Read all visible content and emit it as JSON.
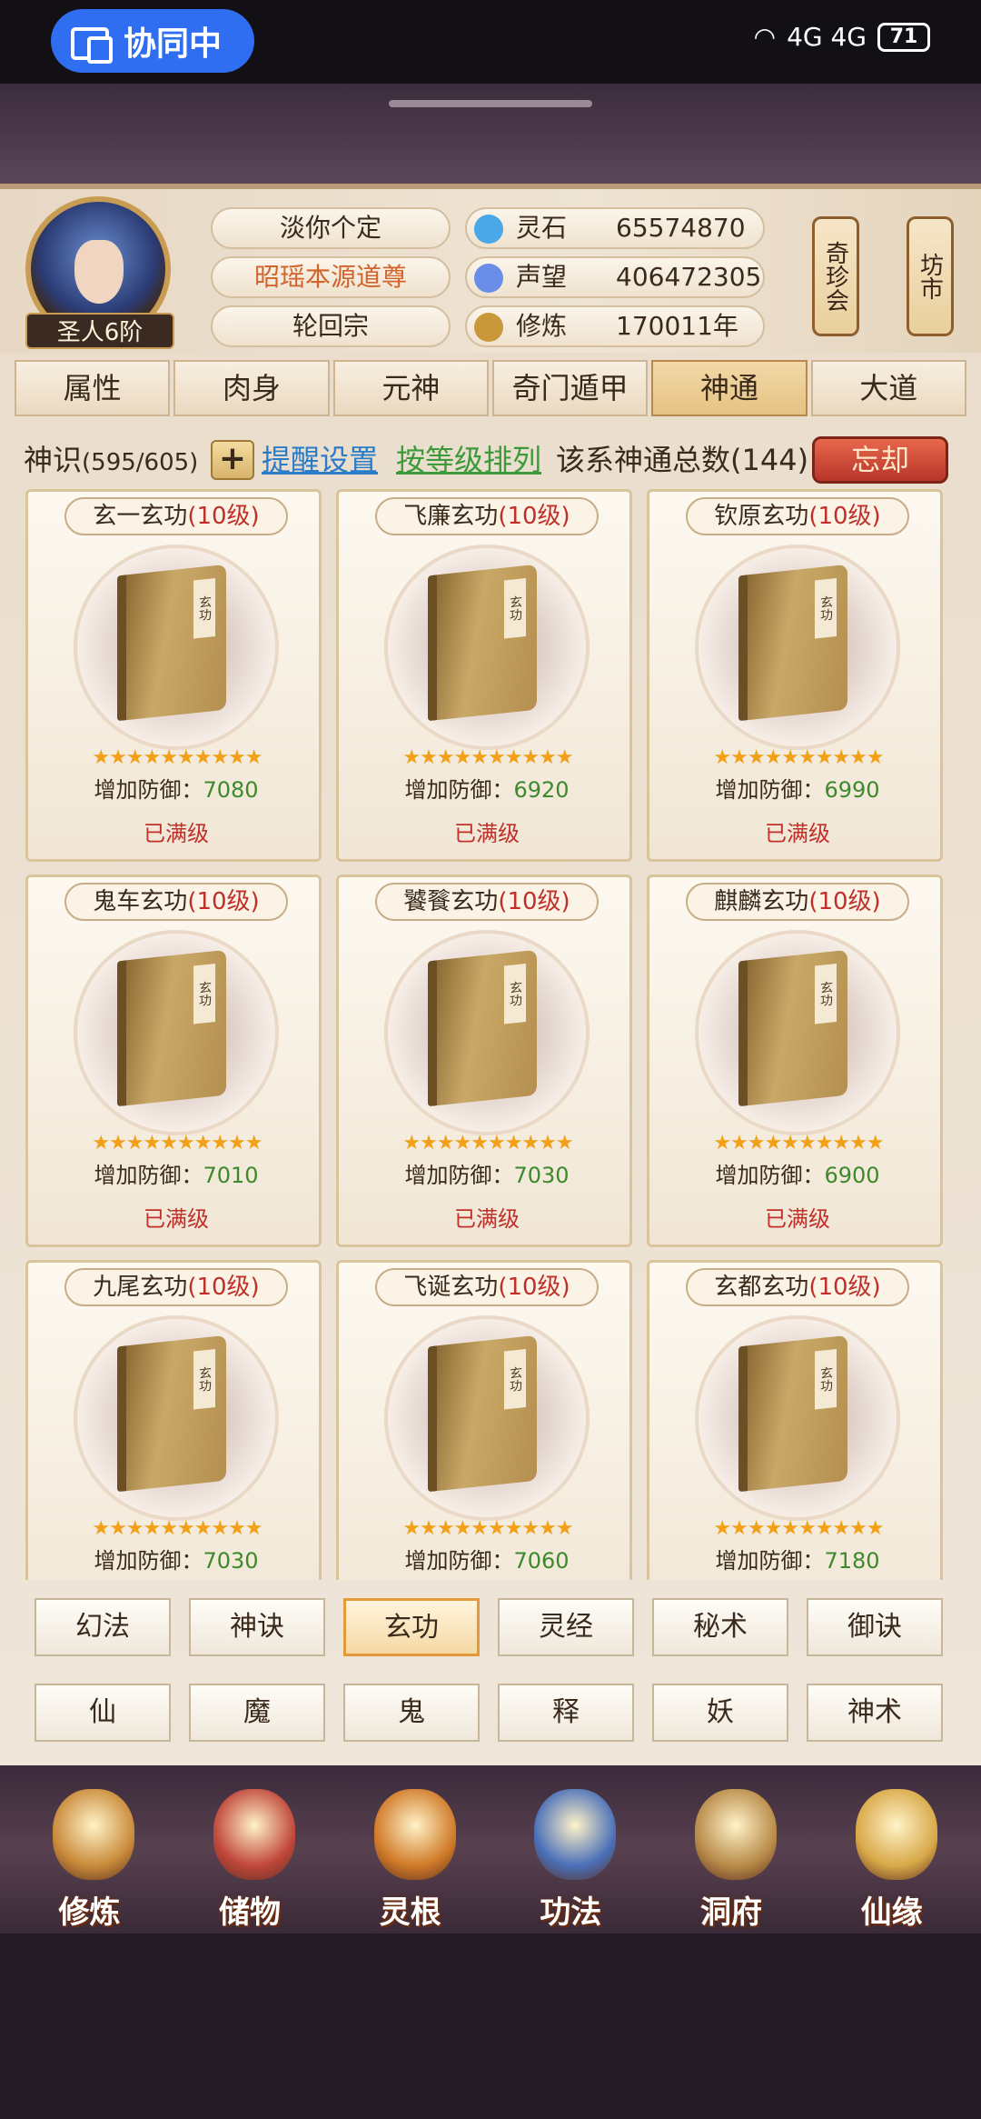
{
  "status": {
    "coop": "协同中",
    "network": "4G 4G",
    "battery": "71"
  },
  "player": {
    "rank": "圣人6阶",
    "name": "淡你个定",
    "title": "昭瑶本源道尊",
    "sect": "轮回宗",
    "stats": [
      {
        "label": "灵石",
        "value": "65574870",
        "color": "#4aa8e8"
      },
      {
        "label": "声望",
        "value": "406472305",
        "color": "#6a8ee8"
      },
      {
        "label": "修炼",
        "value": "170011年",
        "color": "#c9983a"
      }
    ],
    "side_buttons": [
      "奇珍会",
      "坊市"
    ]
  },
  "tabs": [
    "属性",
    "肉身",
    "元神",
    "奇门遁甲",
    "神通",
    "大道"
  ],
  "active_tab": "神通",
  "info": {
    "label": "神识",
    "count": "(595/605)",
    "plus": "+",
    "reminder": "提醒设置",
    "sort": "按等级排列",
    "total": "该系神通总数(144)",
    "forget": "忘却"
  },
  "cards": [
    {
      "name": "玄一玄功",
      "level": "(10级)",
      "stars": "★★★★★★★★★★",
      "effect_label": "增加防御：",
      "effect_value": "7080",
      "status": "已满级"
    },
    {
      "name": "飞廉玄功",
      "level": "(10级)",
      "stars": "★★★★★★★★★★",
      "effect_label": "增加防御：",
      "effect_value": "6920",
      "status": "已满级"
    },
    {
      "name": "钦原玄功",
      "level": "(10级)",
      "stars": "★★★★★★★★★★",
      "effect_label": "增加防御：",
      "effect_value": "6990",
      "status": "已满级"
    },
    {
      "name": "鬼车玄功",
      "level": "(10级)",
      "stars": "★★★★★★★★★★",
      "effect_label": "增加防御：",
      "effect_value": "7010",
      "status": "已满级"
    },
    {
      "name": "饕餮玄功",
      "level": "(10级)",
      "stars": "★★★★★★★★★★",
      "effect_label": "增加防御：",
      "effect_value": "7030",
      "status": "已满级"
    },
    {
      "name": "麒麟玄功",
      "level": "(10级)",
      "stars": "★★★★★★★★★★",
      "effect_label": "增加防御：",
      "effect_value": "6900",
      "status": "已满级"
    },
    {
      "name": "九尾玄功",
      "level": "(10级)",
      "stars": "★★★★★★★★★★",
      "effect_label": "增加防御：",
      "effect_value": "7030",
      "status": ""
    },
    {
      "name": "飞诞玄功",
      "level": "(10级)",
      "stars": "★★★★★★★★★★",
      "effect_label": "增加防御：",
      "effect_value": "7060",
      "status": ""
    },
    {
      "name": "玄都玄功",
      "level": "(10级)",
      "stars": "★★★★★★★★★★",
      "effect_label": "增加防御：",
      "effect_value": "7180",
      "status": ""
    }
  ],
  "book_tag": "玄功",
  "categories": [
    [
      "幻法",
      "神诀",
      "玄功",
      "灵经",
      "秘术",
      "御诀"
    ],
    [
      "仙",
      "魔",
      "鬼",
      "释",
      "妖",
      "神术"
    ]
  ],
  "active_category": "玄功",
  "nav": [
    {
      "label": "修炼",
      "icon": "cultivate-icon",
      "color": "#c98a3a"
    },
    {
      "label": "储物",
      "icon": "storage-bag-icon",
      "color": "#c0463a"
    },
    {
      "label": "灵根",
      "icon": "spirit-root-icon",
      "color": "#d07a28"
    },
    {
      "label": "功法",
      "icon": "skill-book-icon",
      "color": "#4a6fb8"
    },
    {
      "label": "洞府",
      "icon": "cave-house-icon",
      "color": "#b88a48"
    },
    {
      "label": "仙缘",
      "icon": "fortune-gourd-icon",
      "color": "#d8a848"
    }
  ]
}
